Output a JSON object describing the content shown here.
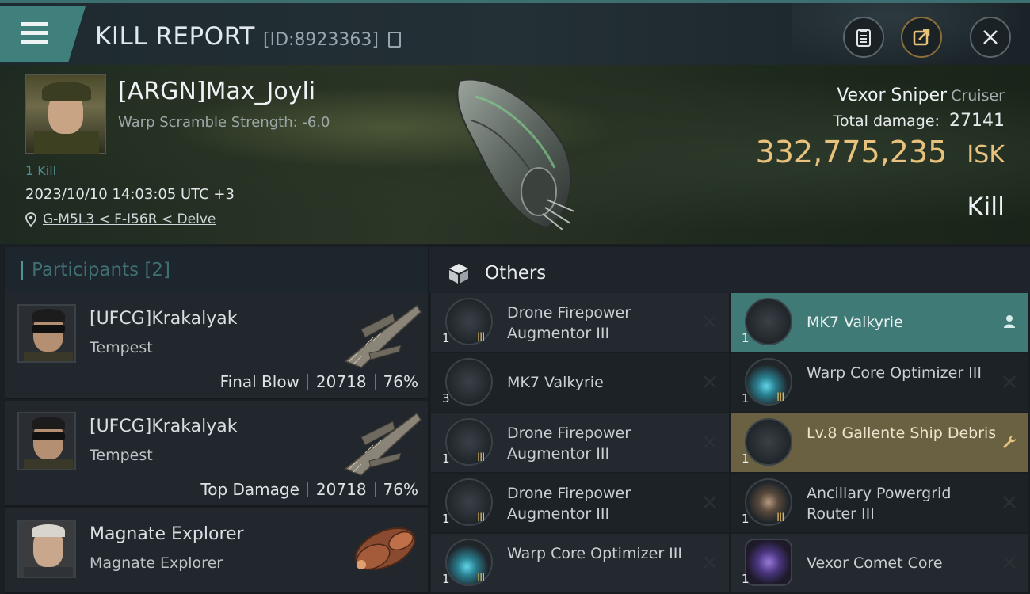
{
  "header": {
    "title": "KILL REPORT",
    "report_id": "[ID:8923363]"
  },
  "victim": {
    "name": "[ARGN]Max_Joyli",
    "warp_scramble": "Warp Scramble Strength: -6.0",
    "kill_count": "1 Kill",
    "timestamp": "2023/10/10 14:03:05 UTC +3",
    "location": "G-M5L3 < F-I56R < Delve",
    "ship_name": "Vexor Sniper",
    "ship_class": "Cruiser",
    "total_damage_label": "Total damage:",
    "total_damage": "27141",
    "isk_value": "332,775,235",
    "isk_unit": "ISK",
    "result": "Kill"
  },
  "participants": {
    "title": "Participants [2]",
    "cards": [
      {
        "name": "[UFCG]Krakalyak",
        "ship": "Tempest",
        "role": "Final Blow",
        "damage": "20718",
        "percent": "76%"
      },
      {
        "name": "[UFCG]Krakalyak",
        "ship": "Tempest",
        "role": "Top Damage",
        "damage": "20718",
        "percent": "76%"
      },
      {
        "name": "Magnate Explorer",
        "ship": "Magnate Explorer"
      }
    ]
  },
  "others": {
    "title": "Others",
    "items": [
      {
        "name": "Drone Firepower Augmentor III",
        "qty": "1",
        "tier": "III"
      },
      {
        "name": "MK7  Valkyrie",
        "qty": "1",
        "tier": ""
      },
      {
        "name": "MK7  Valkyrie",
        "qty": "3",
        "tier": ""
      },
      {
        "name": "Warp Core Optimizer III",
        "qty": "1",
        "tier": "III"
      },
      {
        "name": "Drone Firepower Augmentor III",
        "qty": "1",
        "tier": "III"
      },
      {
        "name": "Lv.8 Gallente Ship Debris",
        "qty": "1",
        "tier": ""
      },
      {
        "name": "Drone Firepower Augmentor III",
        "qty": "1",
        "tier": "III"
      },
      {
        "name": "Ancillary Powergrid Router III",
        "qty": "1",
        "tier": "III"
      },
      {
        "name": "Warp Core Optimizer III",
        "qty": "1",
        "tier": "III"
      },
      {
        "name": "Vexor Comet Core",
        "qty": "1",
        "tier": ""
      }
    ]
  },
  "colors": {
    "accent_teal": "#3f7f7c",
    "isk_gold": "#e8c27d",
    "tier_gold": "#d6b35e"
  }
}
